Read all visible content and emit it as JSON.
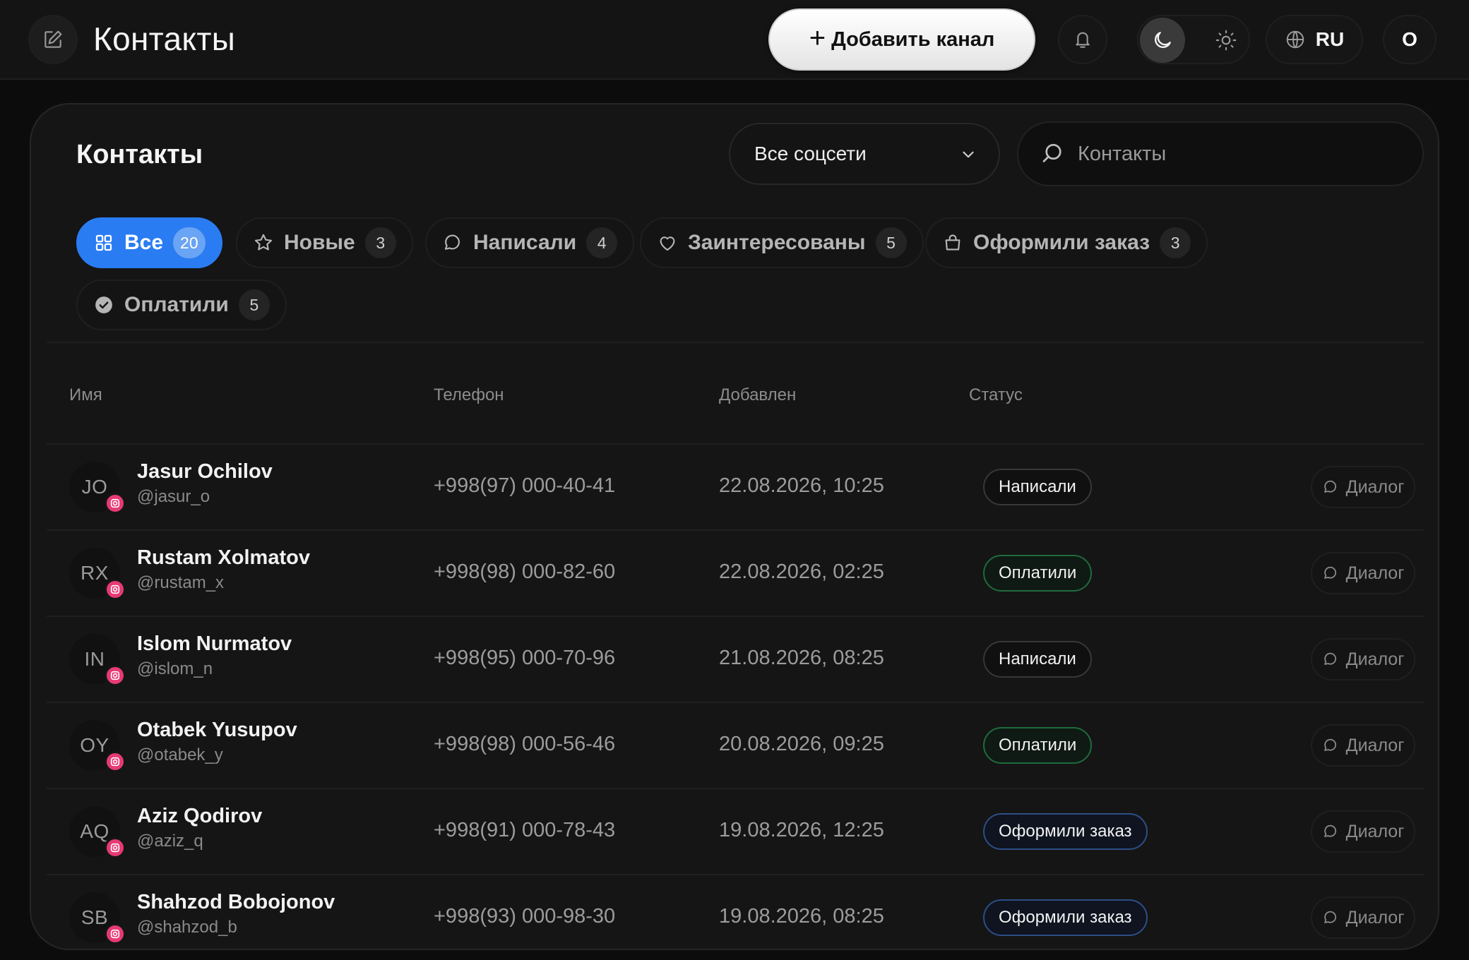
{
  "header": {
    "title": "Контакты",
    "add_channel_label": "Добавить канал",
    "lang_label": "RU",
    "avatar_initial": "O"
  },
  "panel": {
    "title": "Контакты",
    "network_select_value": "Все соцсети",
    "search_placeholder": "Контакты"
  },
  "filters": [
    {
      "label": "Все",
      "count": "20",
      "icon": "grid-icon",
      "active": true
    },
    {
      "label": "Новые",
      "count": "3",
      "icon": "star-icon"
    },
    {
      "label": "Написали",
      "count": "4",
      "icon": "chat-bubble-icon"
    },
    {
      "label": "Заинтересованы",
      "count": "5",
      "icon": "heart-icon"
    },
    {
      "label": "Оформили заказ",
      "count": "3",
      "icon": "shopping-bag-icon"
    },
    {
      "label": "Оплатили",
      "count": "5",
      "icon": "check-circle-icon"
    }
  ],
  "table": {
    "columns": [
      "Имя",
      "Телефон",
      "Добавлен",
      "Статус"
    ],
    "dialog_label": "Диалог",
    "rows": [
      {
        "initials": "JO",
        "name": "Jasur Ochilov",
        "handle": "@jasur_o",
        "phone": "+998(97) 000-40-41",
        "date": "22.08.2026, 10:25",
        "status": "Написали",
        "status_kind": "wrote"
      },
      {
        "initials": "RX",
        "name": "Rustam Xolmatov",
        "handle": "@rustam_x",
        "phone": "+998(98) 000-82-60",
        "date": "22.08.2026, 02:25",
        "status": "Оплатили",
        "status_kind": "paid"
      },
      {
        "initials": "IN",
        "name": "Islom Nurmatov",
        "handle": "@islom_n",
        "phone": "+998(95) 000-70-96",
        "date": "21.08.2026, 08:25",
        "status": "Написали",
        "status_kind": "wrote"
      },
      {
        "initials": "OY",
        "name": "Otabek Yusupov",
        "handle": "@otabek_y",
        "phone": "+998(98) 000-56-46",
        "date": "20.08.2026, 09:25",
        "status": "Оплатили",
        "status_kind": "paid"
      },
      {
        "initials": "AQ",
        "name": "Aziz Qodirov",
        "handle": "@aziz_q",
        "phone": "+998(91) 000-78-43",
        "date": "19.08.2026, 12:25",
        "status": "Оформили заказ",
        "status_kind": "order"
      },
      {
        "initials": "SB",
        "name": "Shahzod Bobojonov",
        "handle": "@shahzod_b",
        "phone": "+998(93) 000-98-30",
        "date": "19.08.2026, 08:25",
        "status": "Оформили заказ",
        "status_kind": "order"
      }
    ]
  },
  "colors": {
    "accent": "#2a7cf2",
    "instagram": "#e73a74",
    "paid_border": "#1f6b3d",
    "order_border": "#2d4e87"
  }
}
